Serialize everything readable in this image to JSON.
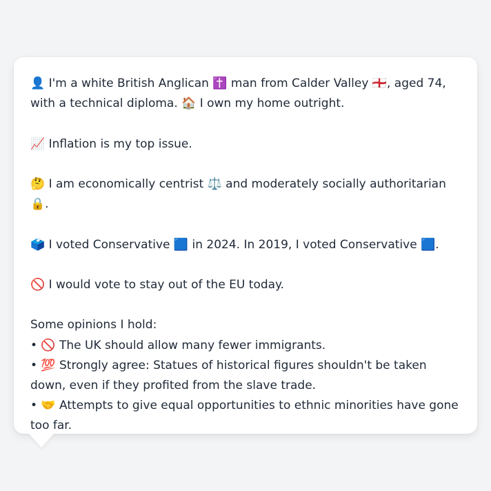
{
  "profile": {
    "intro": "👤 I'm a white British Anglican ✝️ man from Calder Valley 🏴󠁧󠁢󠁥󠁮󠁧󠁿, aged 74, with a technical diploma. 🏠 I own my home outright.",
    "top_issue": "📈 Inflation is my top issue.",
    "ideology": "🤔 I am economically centrist ⚖️ and moderately socially authoritarian 🔒.",
    "votes": "🗳️ I voted Conservative 🟦 in 2024. In 2019, I voted Conservative 🟦.",
    "eu": "🚫 I would vote to stay out of the EU today.",
    "opinions_heading": "Some opinions I hold:",
    "opinions": [
      "• 🚫 The UK should allow many fewer immigrants.",
      "• 💯 Strongly agree: Statues of historical figures shouldn't be taken down, even if they profited from the slave trade.",
      "• 🤝 Attempts to give equal opportunities to ethnic minorities have gone too far."
    ]
  }
}
